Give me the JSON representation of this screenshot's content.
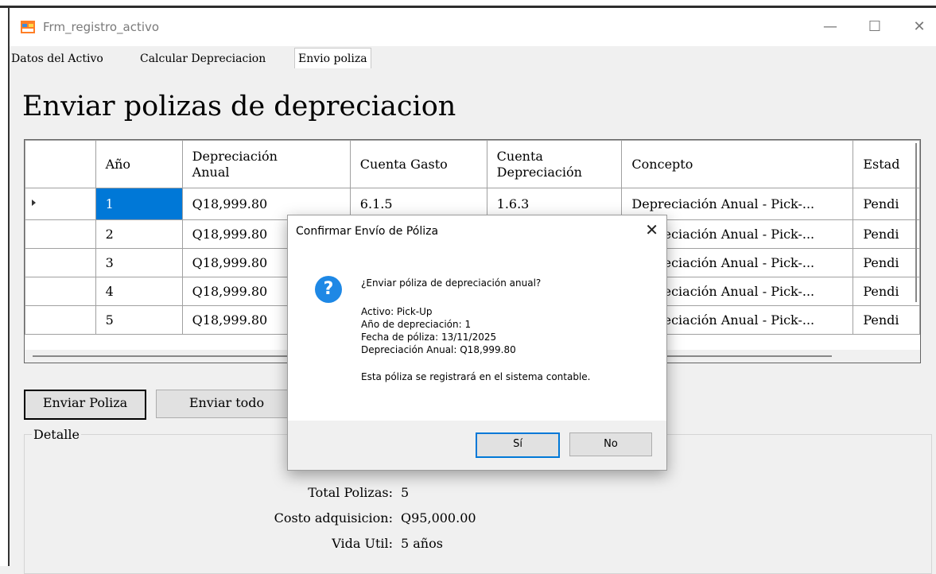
{
  "window": {
    "title": "Frm_registro_activo",
    "minimize": "—",
    "maximize": "☐",
    "close": "✕"
  },
  "tabs": [
    {
      "label": "Datos del Activo"
    },
    {
      "label": "Calcular Depreciacion"
    },
    {
      "label": "Envio poliza"
    }
  ],
  "page": {
    "heading": "Enviar polizas de depreciacion"
  },
  "grid": {
    "columns": [
      "Año",
      "Depreciación\nAnual",
      "Cuenta Gasto",
      "Cuenta\nDepreciación",
      "Concepto",
      "Estad"
    ],
    "rows": [
      [
        "1",
        "Q18,999.80",
        "6.1.5",
        "1.6.3",
        "Depreciación Anual - Pick-...",
        "Pendi"
      ],
      [
        "2",
        "Q18,999.80",
        "",
        "",
        "Depreciación Anual - Pick-...",
        "Pendi"
      ],
      [
        "3",
        "Q18,999.80",
        "",
        "",
        "Depreciación Anual - Pick-...",
        "Pendi"
      ],
      [
        "4",
        "Q18,999.80",
        "",
        "",
        "Depreciación Anual - Pick-...",
        "Pendi"
      ],
      [
        "5",
        "Q18,999.80",
        "",
        "",
        "Depreciación Anual - Pick-...",
        "Pendi"
      ]
    ]
  },
  "buttons": {
    "send": "Enviar Poliza",
    "send_all": "Enviar todo"
  },
  "detail": {
    "title": "Detalle",
    "total_label": "Total Polizas:",
    "total_value": "5",
    "cost_label": "Costo adquisicion:",
    "cost_value": "Q95,000.00",
    "life_label": "Vida Util:",
    "life_value": "5 años"
  },
  "dialog": {
    "title": "Confirmar Envío de Póliza",
    "close": "✕",
    "icon": "question-icon",
    "question": "¿Enviar póliza de depreciación anual?",
    "asset": "Activo: Pick-Up",
    "year": "Año de depreciación: 1",
    "date": "Fecha de póliza: 13/11/2025",
    "amount": "Depreciación Anual: Q18,999.80",
    "note": "Esta póliza se registrará en el sistema contable.",
    "yes": "Sí",
    "no": "No"
  }
}
